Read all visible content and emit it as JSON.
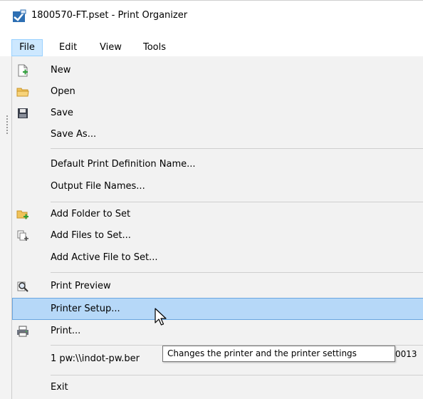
{
  "window": {
    "title": "1800570-FT.pset - Print Organizer",
    "app_icon": "print-organizer-icon"
  },
  "menubar": {
    "file": "File",
    "edit": "Edit",
    "view": "View",
    "tools": "Tools"
  },
  "file_menu": {
    "items": [
      {
        "label": "New",
        "icon": "new-file-icon"
      },
      {
        "label": "Open",
        "icon": "open-folder-icon"
      },
      {
        "label": "Save",
        "icon": "save-disk-icon"
      },
      {
        "label": "Save As...",
        "icon": ""
      },
      {
        "label": "Default Print Definition Name...",
        "icon": ""
      },
      {
        "label": "Output File Names...",
        "icon": ""
      },
      {
        "label": "Add Folder to Set",
        "icon": "add-folder-icon"
      },
      {
        "label": "Add Files to Set...",
        "icon": "add-files-icon"
      },
      {
        "label": "Add Active File to Set...",
        "icon": ""
      },
      {
        "label": "Print Preview",
        "icon": "print-preview-icon"
      },
      {
        "label": "Printer Setup...",
        "icon": "",
        "highlighted": true
      },
      {
        "label": "Print...",
        "icon": "printer-icon"
      },
      {
        "label": "1 pw:\\\\indot-pw.ber",
        "icon": ""
      },
      {
        "label": "Exit",
        "icon": ""
      }
    ],
    "recent_tail": "0013"
  },
  "tooltip": {
    "text": "Changes the printer and the printer settings"
  },
  "colors": {
    "highlight": "#b6d8f8",
    "menu_active": "#cde8ff",
    "menu_bg": "#f2f2f2"
  }
}
